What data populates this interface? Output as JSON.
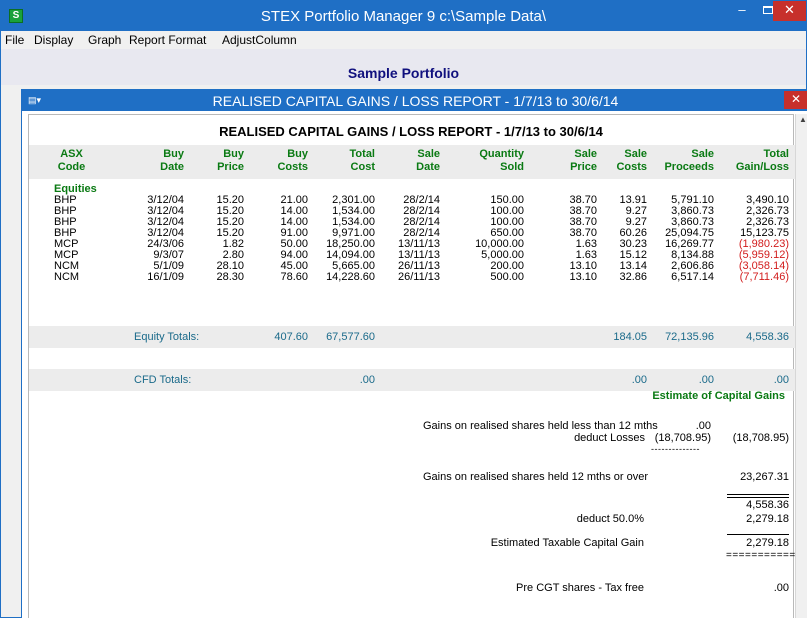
{
  "window": {
    "title": "STEX Portfolio Manager 9  c:\\Sample Data\\",
    "minimize": "–",
    "close": "✕"
  },
  "menu": [
    "File",
    "Display",
    "Graph",
    "Report Format",
    "AdjustColumn"
  ],
  "portfolio_title": "Sample Portfolio",
  "child": {
    "title": "REALISED CAPITAL GAINS / LOSS REPORT - 1/7/13 to 30/6/14",
    "close": "✕"
  },
  "report": {
    "heading": "REALISED CAPITAL GAINS / LOSS REPORT - 1/7/13 to 30/6/14",
    "columns": [
      [
        "ASX",
        "Code"
      ],
      [
        "Buy",
        "Date"
      ],
      [
        "Buy",
        "Price"
      ],
      [
        "Buy",
        "Costs"
      ],
      [
        "Total",
        "Cost"
      ],
      [
        "Sale",
        "Date"
      ],
      [
        "Quantity",
        "Sold"
      ],
      [
        "Sale",
        "Price"
      ],
      [
        "Sale",
        "Costs"
      ],
      [
        "Sale",
        "Proceeds"
      ],
      [
        "Total",
        "Gain/Loss"
      ]
    ],
    "section": "Equities",
    "rows": [
      [
        "BHP",
        "3/12/04",
        "15.20",
        "21.00",
        "2,301.00",
        "28/2/14",
        "150.00",
        "38.70",
        "13.91",
        "5,791.10",
        "3,490.10"
      ],
      [
        "BHP",
        "3/12/04",
        "15.20",
        "14.00",
        "1,534.00",
        "28/2/14",
        "100.00",
        "38.70",
        "9.27",
        "3,860.73",
        "2,326.73"
      ],
      [
        "BHP",
        "3/12/04",
        "15.20",
        "14.00",
        "1,534.00",
        "28/2/14",
        "100.00",
        "38.70",
        "9.27",
        "3,860.73",
        "2,326.73"
      ],
      [
        "BHP",
        "3/12/04",
        "15.20",
        "91.00",
        "9,971.00",
        "28/2/14",
        "650.00",
        "38.70",
        "60.26",
        "25,094.75",
        "15,123.75"
      ],
      [
        "MCP",
        "24/3/06",
        "1.82",
        "50.00",
        "18,250.00",
        "13/11/13",
        "10,000.00",
        "1.63",
        "30.23",
        "16,269.77",
        "(1,980.23)"
      ],
      [
        "MCP",
        "9/3/07",
        "2.80",
        "94.00",
        "14,094.00",
        "13/11/13",
        "5,000.00",
        "1.63",
        "15.12",
        "8,134.88",
        "(5,959.12)"
      ],
      [
        "NCM",
        "5/1/09",
        "28.10",
        "45.00",
        "5,665.00",
        "26/11/13",
        "200.00",
        "13.10",
        "13.14",
        "2,606.86",
        "(3,058.14)"
      ],
      [
        "NCM",
        "16/1/09",
        "28.30",
        "78.60",
        "14,228.60",
        "26/11/13",
        "500.00",
        "13.10",
        "32.86",
        "6,517.14",
        "(7,711.46)"
      ]
    ],
    "equity_totals": {
      "label": "Equity Totals:",
      "buy_costs": "407.60",
      "total_cost": "67,577.60",
      "sale_costs": "184.05",
      "sale_proceeds": "72,135.96",
      "total_gain": "4,558.36"
    },
    "cfd_totals": {
      "label": "CFD Totals:",
      "total_cost": ".00",
      "sale_costs": ".00",
      "sale_proceeds": ".00",
      "total_gain": ".00"
    },
    "estimate": {
      "title": "Estimate of Capital Gains",
      "lt12_label": "Gains on realised shares held less than 12 mths",
      "lt12_value": ".00",
      "deduct_losses_label": "deduct Losses",
      "deduct_losses_value": "(18,708.95)",
      "deduct_losses_total": "(18,708.95)",
      "dashes_short": "--------------",
      "ge12_label": "Gains on realised shares held 12 mths or over",
      "ge12_value": "23,267.31",
      "net_value": "4,558.36",
      "deduct_pct_label": "deduct 50.0%",
      "deduct_pct_value": "2,279.18",
      "taxable_label": "Estimated Taxable Capital Gain",
      "taxable_value": "2,279.18",
      "double_rule": "===========",
      "precgt_label": "Pre CGT shares - Tax free",
      "precgt_value": ".00"
    }
  }
}
